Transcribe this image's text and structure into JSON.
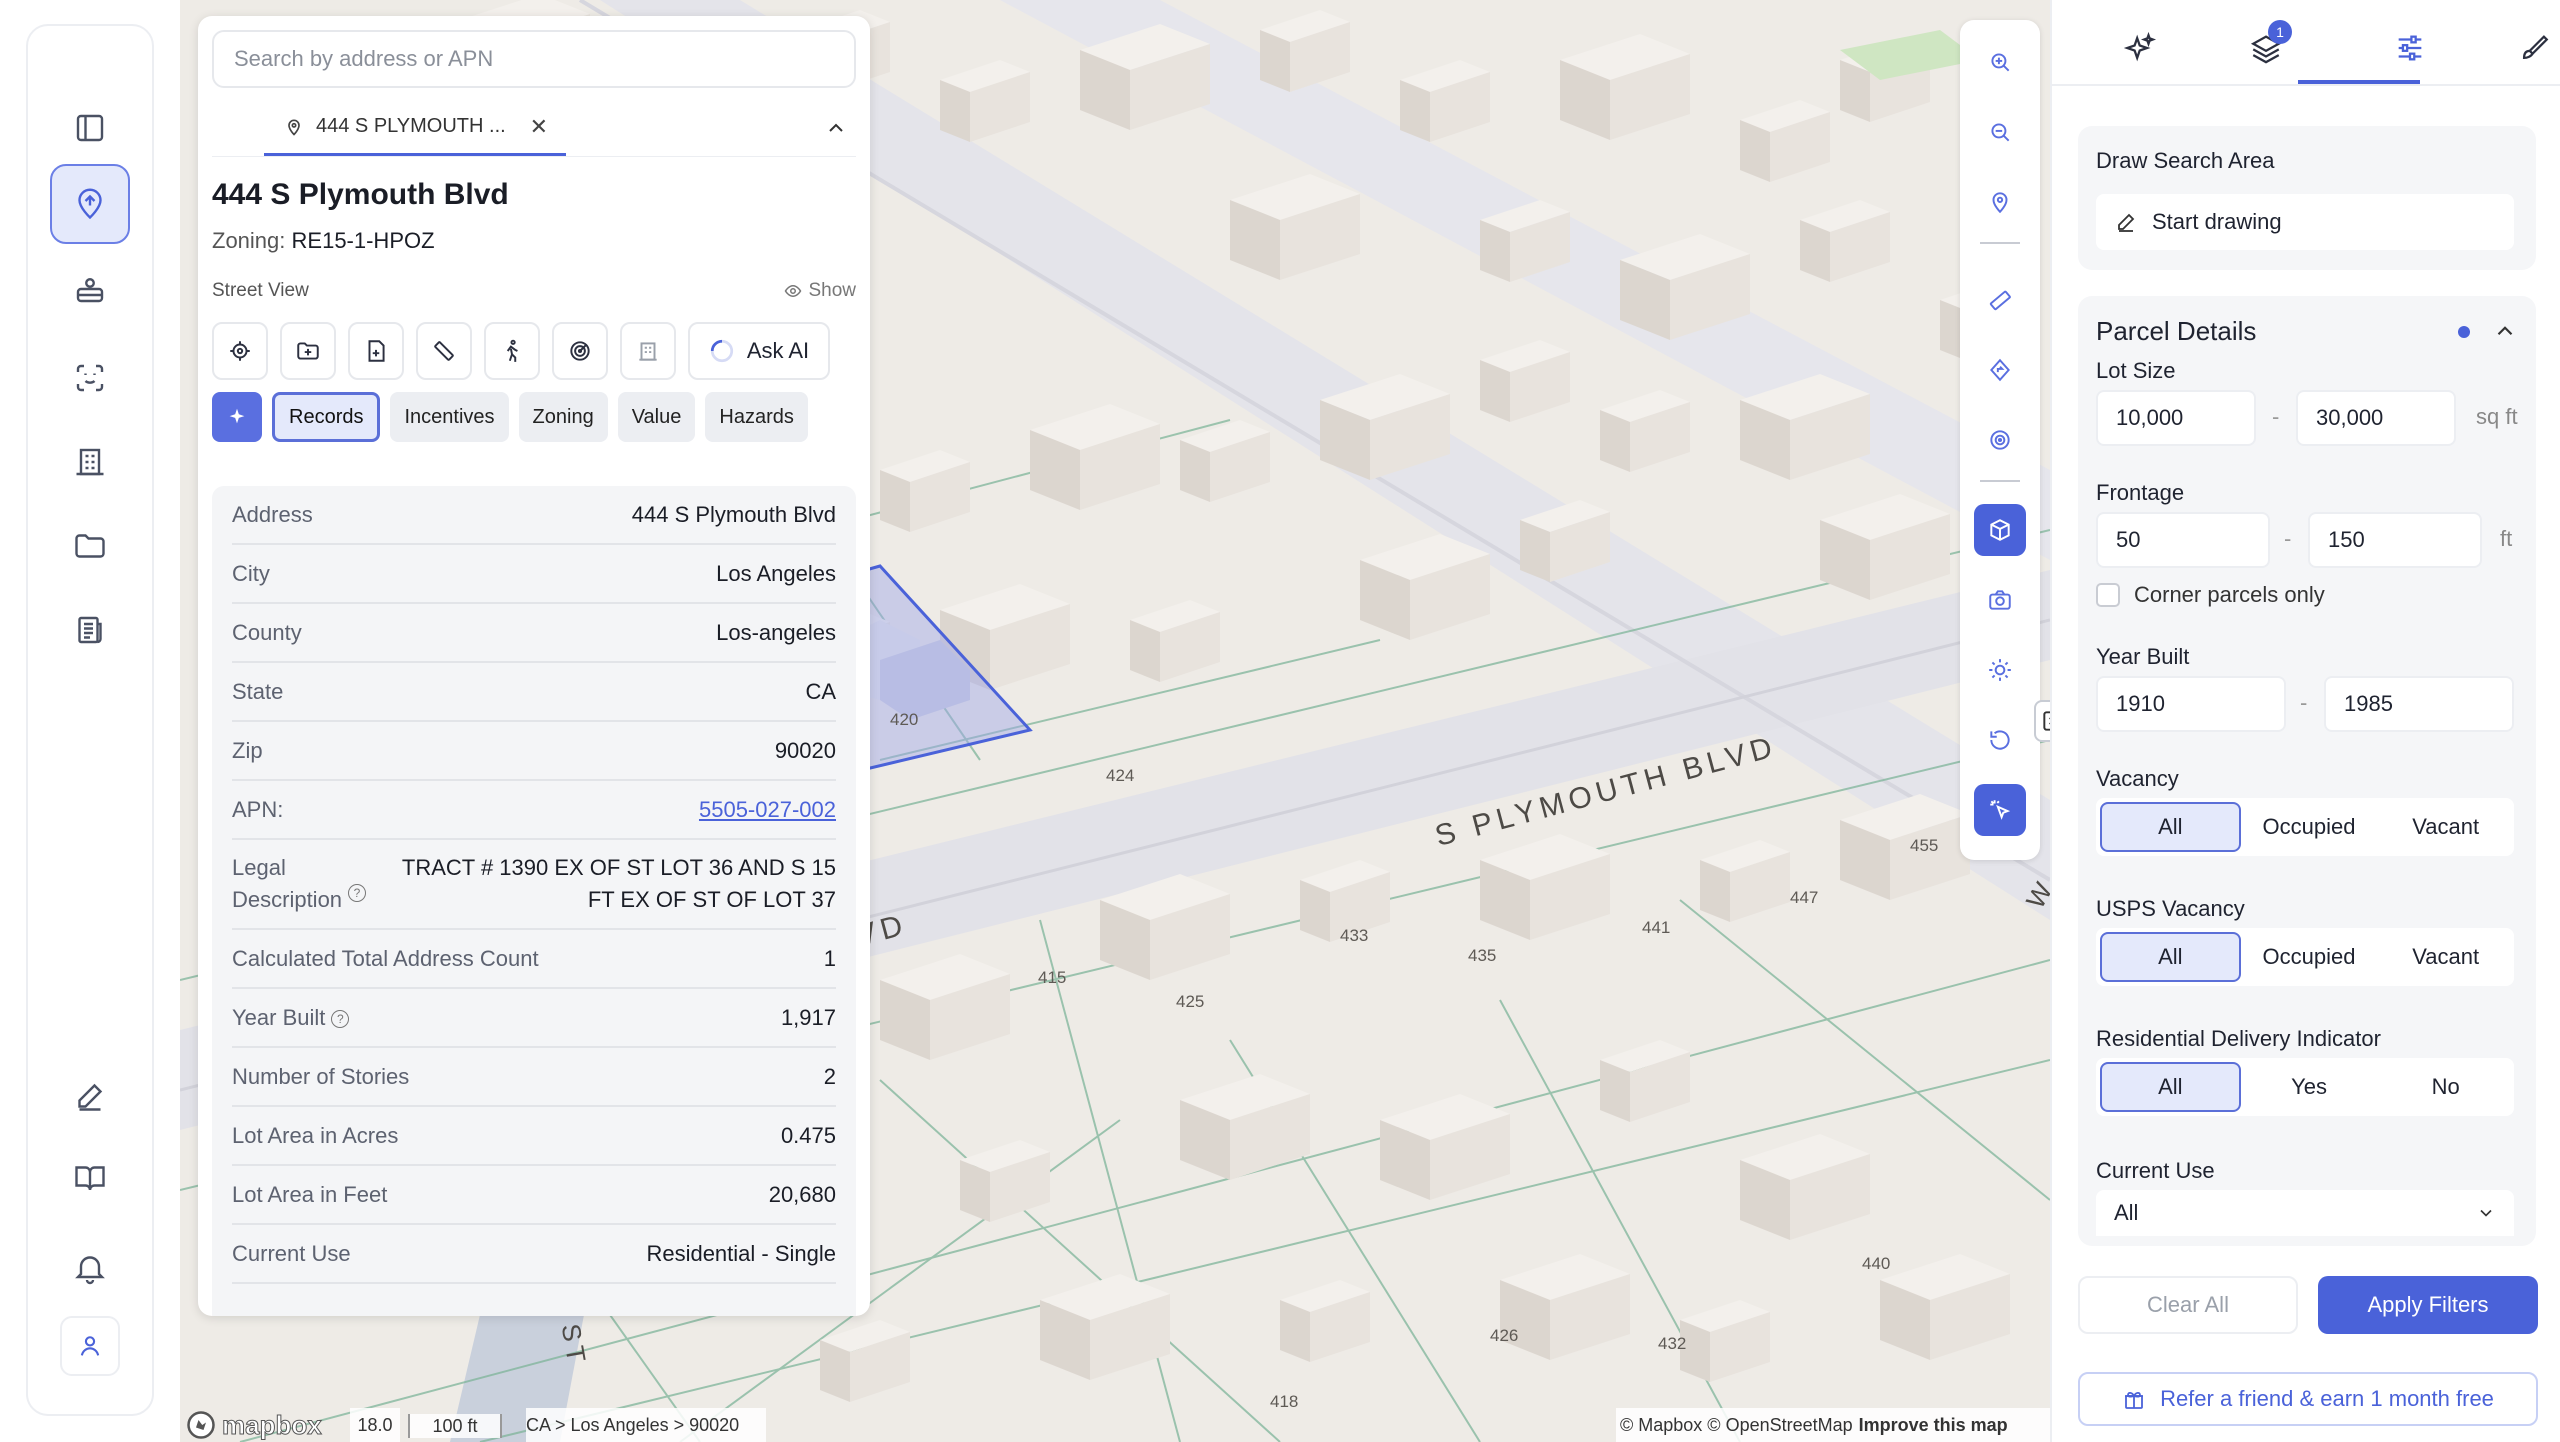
{
  "rail": {
    "items": [
      "sidebar-toggle",
      "map-pin",
      "truck",
      "face-scan",
      "building",
      "folder",
      "document",
      "edit",
      "book",
      "bell",
      "user"
    ]
  },
  "panel": {
    "search_placeholder": "Search by address or APN",
    "tab_label": "444 S PLYMOUTH ...",
    "title": "444 S Plymouth Blvd",
    "zoning_label": "Zoning:",
    "zoning_value": "RE15-1-HPOZ",
    "street_view_label": "Street View",
    "show_label": "Show",
    "ask_ai": "Ask AI",
    "chips": [
      "Records",
      "Incentives",
      "Zoning",
      "Value",
      "Hazards"
    ],
    "records": [
      {
        "k": "Address",
        "v": "444 S Plymouth Blvd"
      },
      {
        "k": "City",
        "v": "Los Angeles"
      },
      {
        "k": "County",
        "v": "Los-angeles"
      },
      {
        "k": "State",
        "v": "CA"
      },
      {
        "k": "Zip",
        "v": "90020"
      },
      {
        "k": "APN:",
        "v": "5505-027-002"
      },
      {
        "k": "Legal Description",
        "v": "TRACT # 1390 EX OF ST LOT 36 AND S 15 FT EX OF ST OF LOT 37"
      },
      {
        "k": "Calculated Total Address Count",
        "v": "1"
      },
      {
        "k": "Year Built",
        "v": "1,917"
      },
      {
        "k": "Number of Stories",
        "v": "2"
      },
      {
        "k": "Lot Area in Acres",
        "v": "0.475"
      },
      {
        "k": "Lot Area in Feet",
        "v": "20,680"
      },
      {
        "k": "Current Use",
        "v": "Residential - Single"
      }
    ]
  },
  "map": {
    "street_labels": [
      "S PLYMOUTH BLVD",
      "TH BLVD",
      "ST",
      "W"
    ],
    "parcel_numbers": [
      "420",
      "424",
      "415",
      "425",
      "433",
      "435",
      "441",
      "447",
      "455",
      "426",
      "432",
      "418",
      "440"
    ],
    "zoom": "18.0",
    "scale": "100 ft",
    "breadcrumb": "CA > Los Angeles > 90020",
    "attribution": "© Mapbox © OpenStreetMap",
    "improve": "Improve this map",
    "logo": "mapbox"
  },
  "right": {
    "layers_badge": "1",
    "draw_title": "Draw Search Area",
    "start_drawing": "Start drawing",
    "parcel_title": "Parcel Details",
    "lot_size_label": "Lot Size",
    "lot_min": "10,000",
    "lot_max": "30,000",
    "lot_unit": "sq ft",
    "frontage_label": "Frontage",
    "front_min": "50",
    "front_max": "150",
    "front_unit": "ft",
    "corner_label": "Corner parcels only",
    "year_label": "Year Built",
    "year_min": "1910",
    "year_max": "1985",
    "vacancy_label": "Vacancy",
    "vacancy_opts": [
      "All",
      "Occupied",
      "Vacant"
    ],
    "usps_label": "USPS Vacancy",
    "usps_opts": [
      "All",
      "Occupied",
      "Vacant"
    ],
    "rdi_label": "Residential Delivery Indicator",
    "rdi_opts": [
      "All",
      "Yes",
      "No"
    ],
    "current_use_label": "Current Use",
    "current_use_value": "All",
    "clear_all": "Clear All",
    "apply": "Apply Filters",
    "refer": "Refer a friend & earn 1 month free",
    "dash": "-"
  }
}
